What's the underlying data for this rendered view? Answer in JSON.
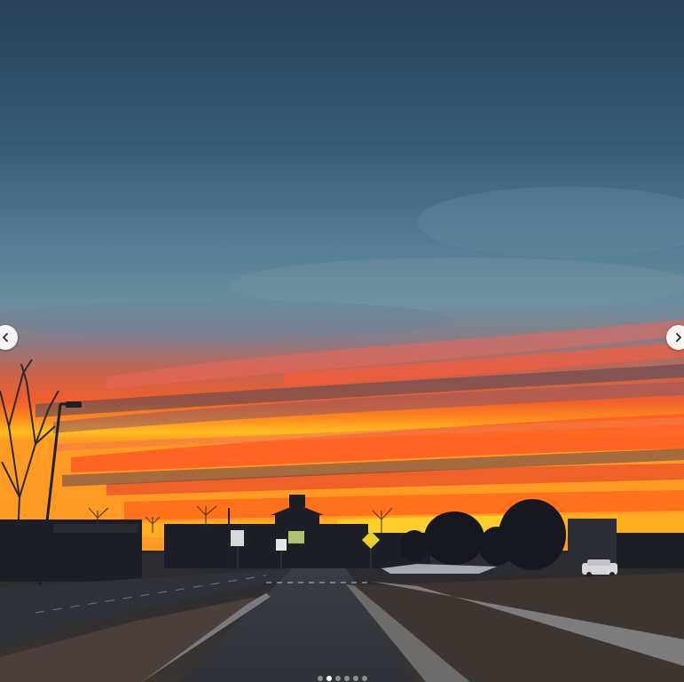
{
  "carousel": {
    "photo_description_icon": "sunset-photo",
    "slide_count": 6,
    "active_slide_index": 1,
    "prev_icon": "chevron-left-icon",
    "next_icon": "chevron-right-icon"
  },
  "colors": {
    "sky_top": "#2a4560",
    "sky_mid": "#4f7f98",
    "glow_orange": "#ff5a1e",
    "glow_yellow": "#ffc21a",
    "silhouette": "#1a1d24"
  }
}
